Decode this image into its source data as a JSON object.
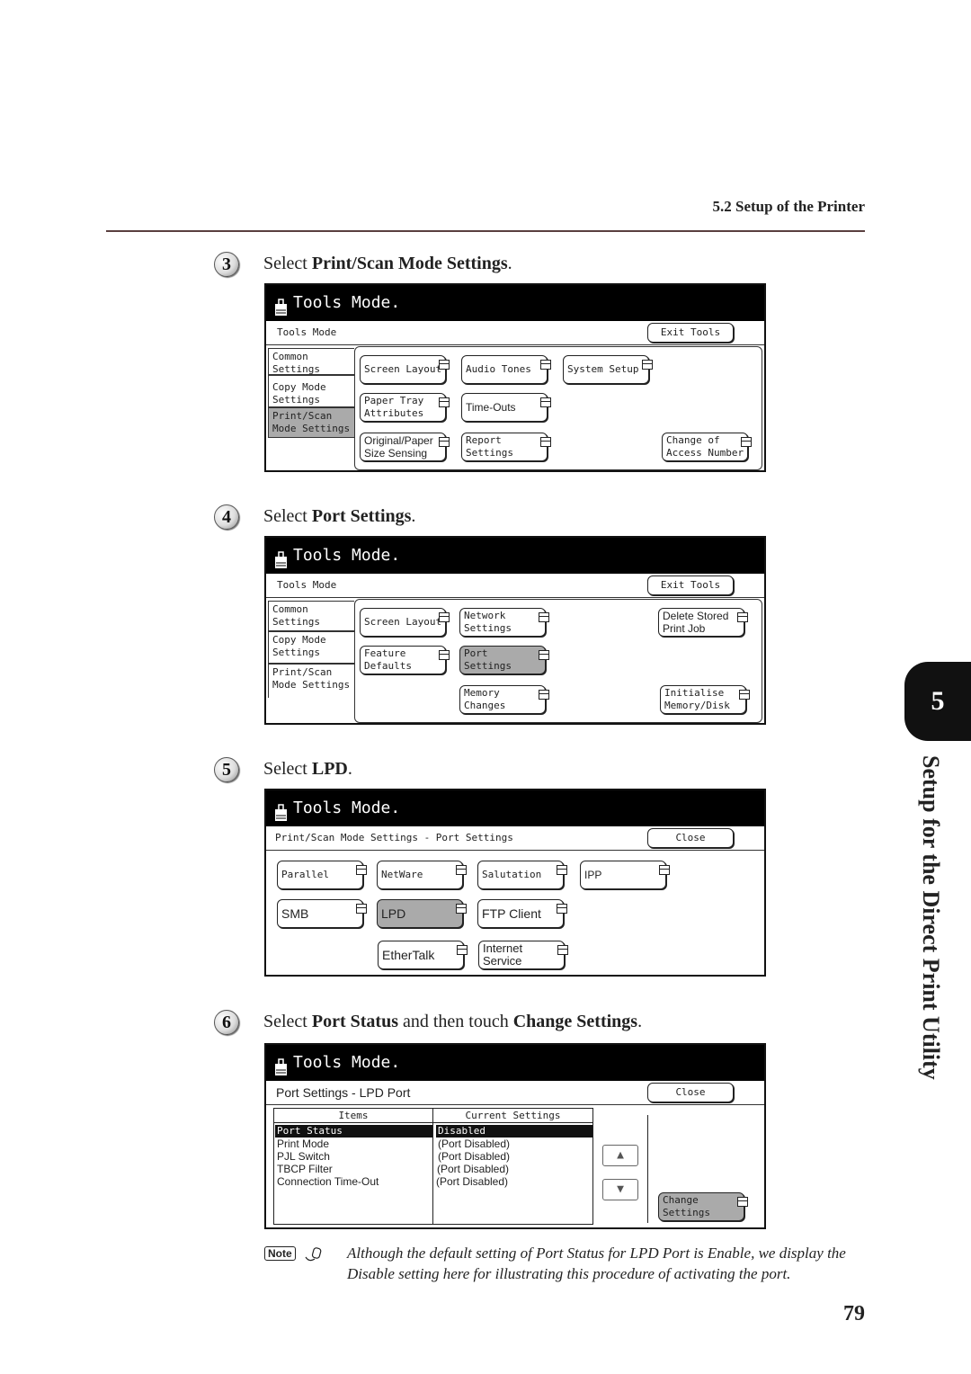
{
  "header": {
    "section": "5.2 Setup of the Printer",
    "page_number": "79"
  },
  "chapter": {
    "number": "5",
    "title": "Setup for the Direct Print Utility"
  },
  "steps": [
    {
      "num": "3",
      "pre": "Select ",
      "bold": "Print/Scan Mode Settings",
      "mid": "",
      "bold2": "",
      "post": "."
    },
    {
      "num": "4",
      "pre": "Select ",
      "bold": "Port Settings",
      "mid": "",
      "bold2": "",
      "post": "."
    },
    {
      "num": "5",
      "pre": "Select ",
      "bold": "LPD",
      "mid": "",
      "bold2": "",
      "post": "."
    },
    {
      "num": "6",
      "pre": "Select ",
      "bold": "Port Status",
      "mid": " and then touch ",
      "bold2": "Change Settings",
      "post": "."
    }
  ],
  "screen1": {
    "title": "Tools Mode.",
    "bar_label": "Tools Mode",
    "exit": "Exit Tools",
    "tabs": [
      "Common\nSettings",
      "Copy Mode\nSettings",
      "Print/Scan\nMode Settings"
    ],
    "buttons": [
      "Screen Layout",
      "Audio Tones",
      "System Setup",
      "Paper Tray\nAttributes",
      "Time-Outs",
      "Original/Paper\nSize Sensing",
      "Report\nSettings",
      "Change of\nAccess Number"
    ]
  },
  "screen2": {
    "title": "Tools Mode.",
    "bar_label": "Tools Mode",
    "exit": "Exit Tools",
    "tabs": [
      "Common\nSettings",
      "Copy Mode\nSettings",
      "Print/Scan\nMode Settings"
    ],
    "buttons": [
      "Screen Layout",
      "Network\nSettings",
      "Delete Stored\nPrint Job",
      "Feature\nDefaults",
      "Port\nSettings",
      "Memory\nChanges",
      "Initialise\nMemory/Disk"
    ]
  },
  "screen3": {
    "title": "Tools Mode.",
    "bar_label": "Print/Scan Mode Settings - Port Settings",
    "close": "Close",
    "buttons": [
      "Parallel",
      "NetWare",
      "Salutation",
      "IPP",
      "SMB",
      "LPD",
      "FTP Client",
      "EtherTalk",
      "Internet\nService"
    ]
  },
  "screen4": {
    "title": "Tools Mode.",
    "bar_label": "Port Settings - LPD Port",
    "close": "Close",
    "columns": [
      "Items",
      "Current Settings"
    ],
    "rows": [
      {
        "item": "Port Status",
        "value": "Disabled"
      },
      {
        "item": "Print Mode",
        "value": "(Port Disabled)"
      },
      {
        "item": "PJL Switch",
        "value": "(Port Disabled)"
      },
      {
        "item": "TBCP Filter",
        "value": "(Port Disabled)"
      },
      {
        "item": "Connection Time-Out",
        "value": "(Port Disabled)"
      }
    ],
    "up": "▲",
    "down": "▼",
    "change": "Change\nSettings"
  },
  "note": {
    "badge": "Note",
    "text": "Although the default setting of Port Status for LPD Port is Enable, we display the Disable setting here for illustrating this procedure of activating the port."
  }
}
